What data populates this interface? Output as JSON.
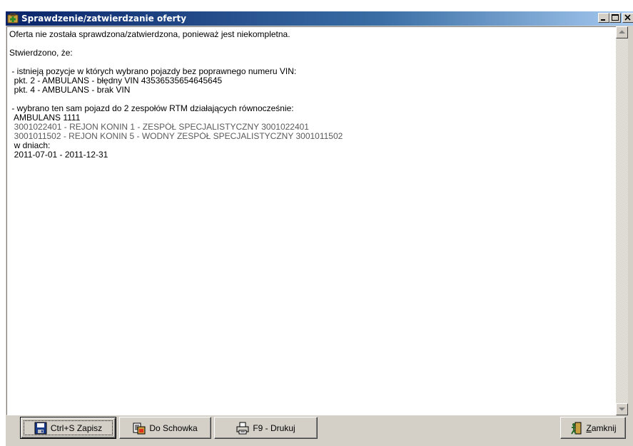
{
  "window": {
    "title": "Sprawdzenie/zatwierdzanie oferty",
    "title_icon": "first-aid-icon",
    "controls": [
      "minimize",
      "maximize",
      "close"
    ]
  },
  "message": {
    "lines": [
      "Oferta nie została sprawdzona/zatwierdzona, ponieważ jest niekompletna.",
      "",
      "Stwierdzono, że:",
      "",
      " - istnieją pozycje w których wybrano pojazdy bez poprawnego numeru VIN:",
      "  pkt. 2 - AMBULANS - błędny VIN 43536535654645645",
      "  pkt. 4 - AMBULANS - brak VIN",
      "",
      " - wybrano ten sam pojazd do 2 zespołów RTM działających równocześnie:",
      "  AMBULANS 1111",
      "  3001022401 - REJON KONIN 1 - ZESPÓŁ SPECJALISTYCZNY 3001022401",
      "  3001011502 - REJON KONIN 5 - WODNY ZESPÓŁ SPECJALISTYCZNY 3001011502",
      "  w dniach:",
      "  2011-07-01 - 2011-12-31"
    ]
  },
  "buttons": {
    "save": {
      "label": "Ctrl+S Zapisz",
      "icon": "floppy-disk-icon"
    },
    "copy": {
      "label": "Do Schowka",
      "icon": "clipboard-icon"
    },
    "print": {
      "label": "F9 - Drukuj",
      "icon": "printer-icon"
    },
    "close": {
      "label_mnemonic": "Z",
      "label_rest": "amknij",
      "icon": "exit-door-icon"
    }
  },
  "colors": {
    "titlebar_start": "#0a246a",
    "titlebar_end": "#a6caf0",
    "face": "#d4d0c8"
  }
}
